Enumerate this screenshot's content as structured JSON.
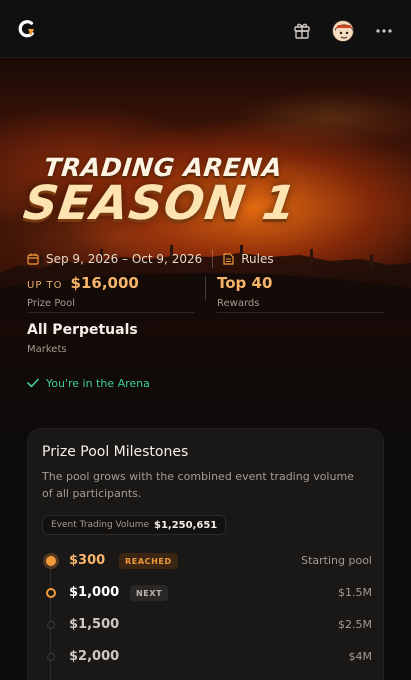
{
  "header": {
    "logo": "app-logo",
    "gift_icon": "gift-icon",
    "avatar": "user-avatar",
    "more_icon": "more-horizontal-icon"
  },
  "hero": {
    "title_line1": "TRADING ARENA",
    "title_line2": "SEASON 1",
    "date_range": "Sep 9, 2026 – Oct 9, 2026",
    "rules_label": "Rules",
    "accent": "#f6b56a"
  },
  "stats": {
    "upto_label": "UP TO",
    "prize_value": "$16,000",
    "prize_label": "Prize Pool",
    "top_value": "Top 40",
    "top_label": "Rewards",
    "markets_value": "All Perpetuals",
    "markets_label": "Markets"
  },
  "status": {
    "text": "You're in the Arena",
    "color": "#3fcf8e"
  },
  "milestones": {
    "title": "Prize Pool Milestones",
    "description": "The pool grows with the combined event trading volume of all participants.",
    "volume_label": "Event Trading Volume",
    "volume_value": "$1,250,651",
    "items": [
      {
        "amount": "$300",
        "badge": "REACHED",
        "right": "Starting pool",
        "state": "reached"
      },
      {
        "amount": "$1,000",
        "badge": "NEXT",
        "right": "$1.5M",
        "state": "next"
      },
      {
        "amount": "$1,500",
        "badge": "",
        "right": "$2.5M",
        "state": "future"
      },
      {
        "amount": "$2,000",
        "badge": "",
        "right": "$4M",
        "state": "future"
      }
    ]
  }
}
